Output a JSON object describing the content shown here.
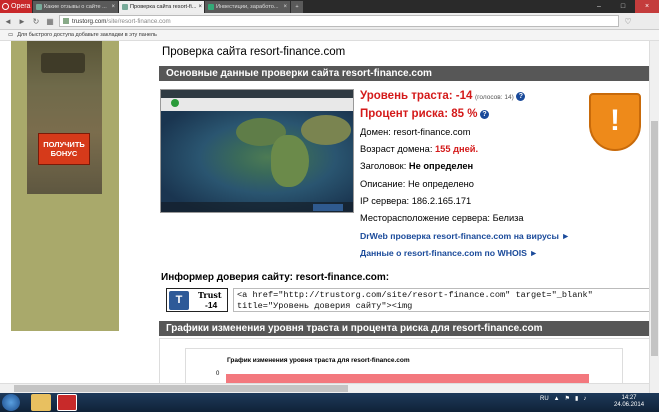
{
  "browser": {
    "opera_label": "Opera",
    "tabs": [
      {
        "label": "Какие отзывы о сайте ...",
        "active": false
      },
      {
        "label": "Проверка сайта resort-fi...",
        "active": true
      },
      {
        "label": "Инвестиции, заработо...",
        "active": false
      }
    ],
    "url_host": "trustorg.com",
    "url_path": "/site/resort-finance.com",
    "bookmarks_hint": "Для быстрого доступа добавьте закладки в эту панель"
  },
  "ad": {
    "button_label": "ПОЛУЧИТЬ БОНУС"
  },
  "page": {
    "title": "Проверка сайта resort-finance.com",
    "section_main": "Основные данные проверки сайта resort-finance.com",
    "trust_label": "Уровень траста: -14",
    "trust_votes": "(голосов: 14)",
    "risk_label": "Процент риска: 85 %",
    "domain_label": "Домен:",
    "domain_value": "resort-finance.com",
    "age_label": "Возраст домена:",
    "age_value": "155 дней.",
    "header_label": "Заголовок:",
    "header_value": "Не определен",
    "desc_label": "Описание:",
    "desc_value": "Не определено",
    "ip_label": "IP сервера:",
    "ip_value": "186.2.165.171",
    "location_label": "Месторасположение сервера:",
    "location_value": "Белиза",
    "drweb_link": "DrWeb проверка resort-finance.com на вирусы ►",
    "whois_link": "Данные о resort-finance.com по WHOIS ►",
    "informer_title": "Информер доверия сайту: resort-finance.com:",
    "badge_trust": "Trust",
    "badge_value": "-14",
    "code_line1": "<a href=\"http://trustorg.com/site/resort-finance.com\" target=\"_blank\"",
    "code_line2": "title=\"Уровень доверия сайту\"><img",
    "section_charts": "Графики изменения уровня траста и процента риска для resort-finance.com",
    "chart_title": "График изменения уровня траста для resort-finance.com",
    "chart_axis_zero": "0"
  },
  "taskbar": {
    "lang": "RU",
    "time": "14:27",
    "date": "24.06.2014"
  },
  "colors": {
    "accent_red": "#d41a1a",
    "link_blue": "#1a4a9a",
    "header_gray": "#575757",
    "warning_orange": "#ee8a1a"
  }
}
